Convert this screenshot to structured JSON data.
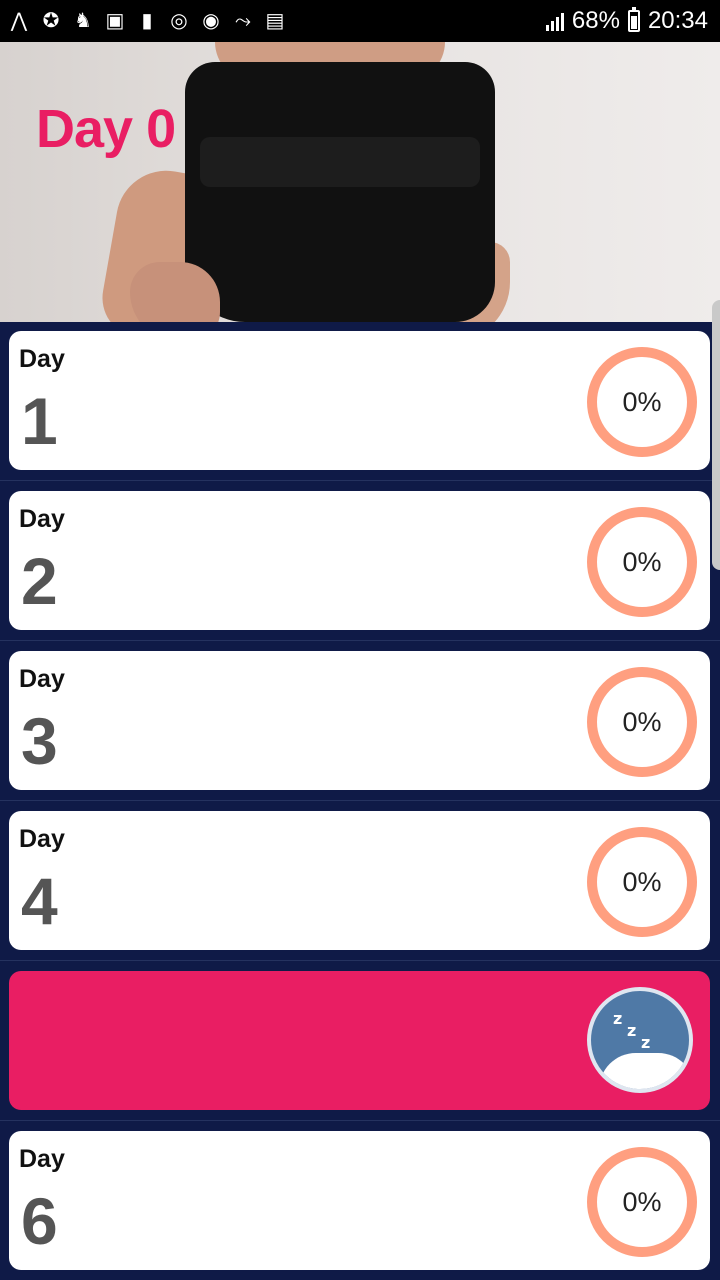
{
  "status_bar": {
    "battery_percent": "68%",
    "time": "20:34",
    "left_icons": [
      "accessibility-icon",
      "fitness-icon",
      "body-icon",
      "gallery-icon",
      "cup-icon",
      "instagram-icon",
      "sync-icon",
      "workout-icon",
      "message-icon"
    ]
  },
  "header": {
    "title": "Day 0"
  },
  "days": [
    {
      "label": "Day",
      "number": "1",
      "progress": "0%"
    },
    {
      "label": "Day",
      "number": "2",
      "progress": "0%"
    },
    {
      "label": "Day",
      "number": "3",
      "progress": "0%"
    },
    {
      "label": "Day",
      "number": "4",
      "progress": "0%"
    },
    {
      "rest": true,
      "icon": "sleep-icon"
    },
    {
      "label": "Day",
      "number": "6",
      "progress": "0%"
    }
  ],
  "colors": {
    "accent": "#e91e63",
    "ring": "#ff9f80",
    "background": "#0f1a47",
    "card": "#ffffff",
    "sleep_badge": "#4f79a6"
  }
}
